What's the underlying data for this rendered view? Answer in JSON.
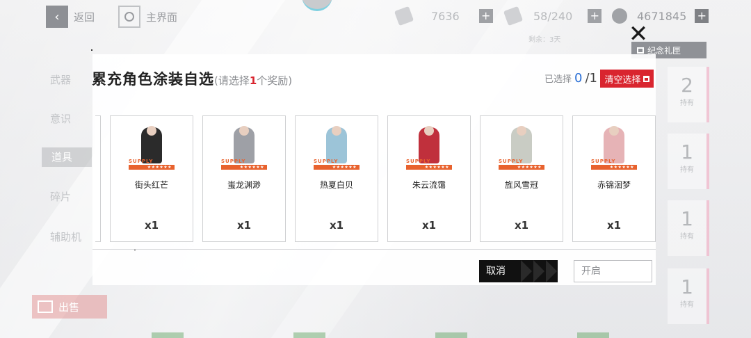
{
  "topbar": {
    "back_label": "返回",
    "home_label": "主界面",
    "resources": [
      {
        "value": "7636",
        "icon": "ticket-icon"
      },
      {
        "value": "58/240",
        "icon": "stamina-icon"
      },
      {
        "value": "4671845",
        "icon": "coin-icon"
      }
    ],
    "plus_label": "+",
    "timer_label": "剩余：3天"
  },
  "sidebar": {
    "items": [
      {
        "label": "武器"
      },
      {
        "label": "意识"
      },
      {
        "label": "道具"
      },
      {
        "label": "碎片"
      },
      {
        "label": "辅助机"
      }
    ]
  },
  "background": {
    "memorial_label": "纪念礼匣",
    "sell_label": "出售",
    "right_counts": [
      {
        "value": "2",
        "label": "持有"
      },
      {
        "value": "1",
        "label": "持有"
      },
      {
        "value": "1",
        "label": "持有"
      },
      {
        "value": "1",
        "label": "持有"
      }
    ]
  },
  "modal": {
    "title": "累充角色涂装自选",
    "subtitle_pre": "(请选择",
    "subtitle_num": "1",
    "subtitle_post": "个奖励)",
    "selected_label": "已选择",
    "selected_current": "0",
    "selected_total": "/1",
    "clear_label": "清空选择",
    "close_symbol": "✕",
    "supply_text": "SUPPLY",
    "supply_stars": "★★★★★★",
    "items": [
      {
        "name": "街头红芒",
        "qty": "x1",
        "color": "#2b2b2b"
      },
      {
        "name": "蚩龙渊渺",
        "qty": "x1",
        "color": "#9ea0a6"
      },
      {
        "name": "热夏白贝",
        "qty": "x1",
        "color": "#9cc4d8"
      },
      {
        "name": "朱云流霭",
        "qty": "x1",
        "color": "#c0303c"
      },
      {
        "name": "旌风雪冠",
        "qty": "x1",
        "color": "#c9ccc4"
      },
      {
        "name": "赤锦洄梦",
        "qty": "x1",
        "color": "#e6b3b6"
      }
    ],
    "cancel_label": "取消",
    "open_label": "开启"
  }
}
